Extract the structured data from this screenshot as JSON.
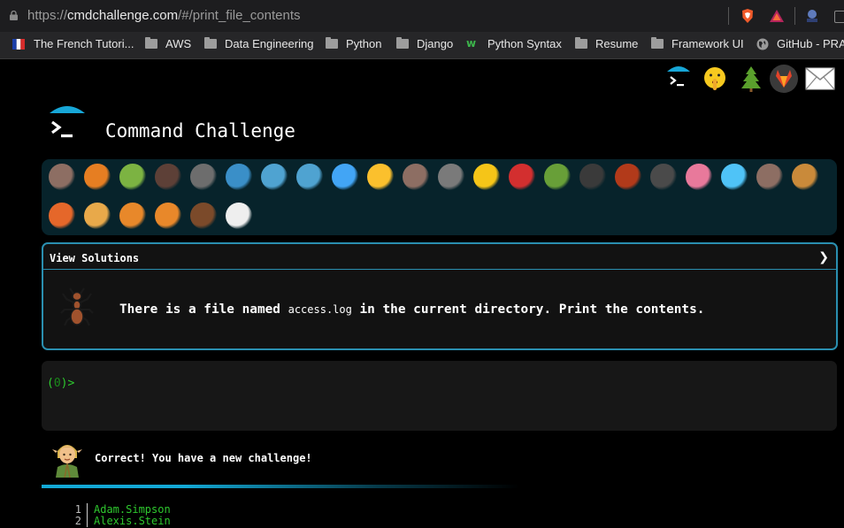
{
  "browser": {
    "url_prefix": "https://",
    "url_host": "cmdchallenge.com",
    "url_path": "/#/print_file_contents",
    "bookmarks": [
      {
        "label": "The French Tutori...",
        "icon": "flag-fr-icon"
      },
      {
        "label": "AWS",
        "icon": "folder-icon"
      },
      {
        "label": "Data Engineering",
        "icon": "folder-icon"
      },
      {
        "label": "Python",
        "icon": "folder-icon"
      },
      {
        "label": "Django",
        "icon": "folder-icon"
      },
      {
        "label": "Python Syntax",
        "icon": "w3-icon"
      },
      {
        "label": "Resume",
        "icon": "folder-icon"
      },
      {
        "label": "Framework UI",
        "icon": "folder-icon"
      },
      {
        "label": "GitHub - PRAT",
        "icon": "globe-icon"
      }
    ]
  },
  "header": {
    "title": "Command Challenge"
  },
  "levels": {
    "rows": [
      [
        "snail",
        "butterfly",
        "caterpillar",
        "ant",
        "spider-web",
        "whale",
        "dolphin",
        "dolphin",
        "fish",
        "tropical-fish",
        "blowfish",
        "wolf",
        "bee",
        "ladybug",
        "worm",
        "spider",
        "scorpion",
        "fly",
        "worm-pink",
        "microbe",
        "monkey",
        "dog"
      ],
      [
        "fox",
        "cat",
        "tiger",
        "tiger",
        "horse",
        "unicorn"
      ]
    ]
  },
  "challenge": {
    "view_solutions": "View Solutions",
    "chevron": "❯",
    "task_before": "There is a file named ",
    "task_file": "access.log",
    "task_after": " in the current directory. Print the contents."
  },
  "terminal": {
    "prompt_open": "(",
    "prompt_num": "0",
    "prompt_close": ")>",
    "input_value": ""
  },
  "feedback": {
    "message": "Correct! You have a new challenge!"
  },
  "output": {
    "lines": [
      {
        "n": "1",
        "text": "Adam.Simpson"
      },
      {
        "n": "2",
        "text": "Alexis.Stein"
      }
    ]
  },
  "colors": {
    "accent": "#2a8fb0",
    "prompt_green": "#2ec82e",
    "levels_bg": "#07232b"
  }
}
